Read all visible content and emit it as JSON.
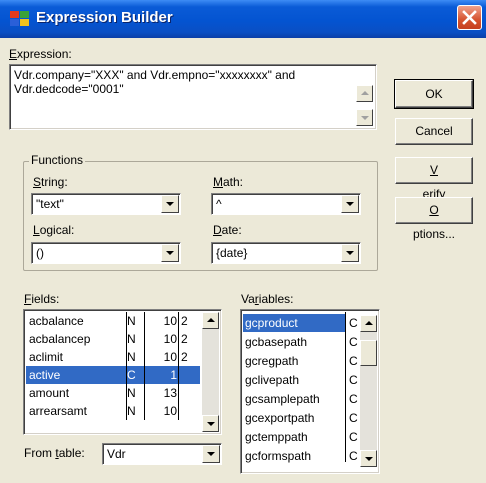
{
  "window": {
    "title": "Expression Builder"
  },
  "expression": {
    "label": "Expression:",
    "value": "Vdr.company=\"XXX\" and Vdr.empno=\"xxxxxxxx\" and Vdr.dedcode=\"0001\""
  },
  "buttons": {
    "ok": "OK",
    "cancel": "Cancel",
    "verify": "Verify",
    "options": "Options..."
  },
  "functions": {
    "title": "Functions",
    "string": {
      "label": "String:",
      "value": "\"text\""
    },
    "math": {
      "label": "Math:",
      "value": "^"
    },
    "logical": {
      "label": "Logical:",
      "value": "()"
    },
    "date": {
      "label": "Date:",
      "value": "{date}"
    }
  },
  "fields": {
    "label": "Fields:",
    "rows": [
      {
        "name": "acbalance",
        "type": "N",
        "len": "10",
        "dec": "2"
      },
      {
        "name": "acbalancep",
        "type": "N",
        "len": "10",
        "dec": "2"
      },
      {
        "name": "aclimit",
        "type": "N",
        "len": "10",
        "dec": "2"
      },
      {
        "name": "active",
        "type": "C",
        "len": "1",
        "dec": ""
      },
      {
        "name": "amount",
        "type": "N",
        "len": "13",
        "dec": ""
      },
      {
        "name": "arrearsamt",
        "type": "N",
        "len": "10",
        "dec": ""
      }
    ],
    "selected_index": 3
  },
  "variables": {
    "label": "Variables:",
    "rows": [
      {
        "name": "gcproduct",
        "type": "C"
      },
      {
        "name": "gcbasepath",
        "type": "C"
      },
      {
        "name": "gcregpath",
        "type": "C"
      },
      {
        "name": "gclivepath",
        "type": "C"
      },
      {
        "name": "gcsamplepath",
        "type": "C"
      },
      {
        "name": "gcexportpath",
        "type": "C"
      },
      {
        "name": "gctemppath",
        "type": "C"
      },
      {
        "name": "gcformspath",
        "type": "C"
      }
    ],
    "selected_index": 0
  },
  "from_table": {
    "label": "From table:",
    "value": "Vdr"
  }
}
